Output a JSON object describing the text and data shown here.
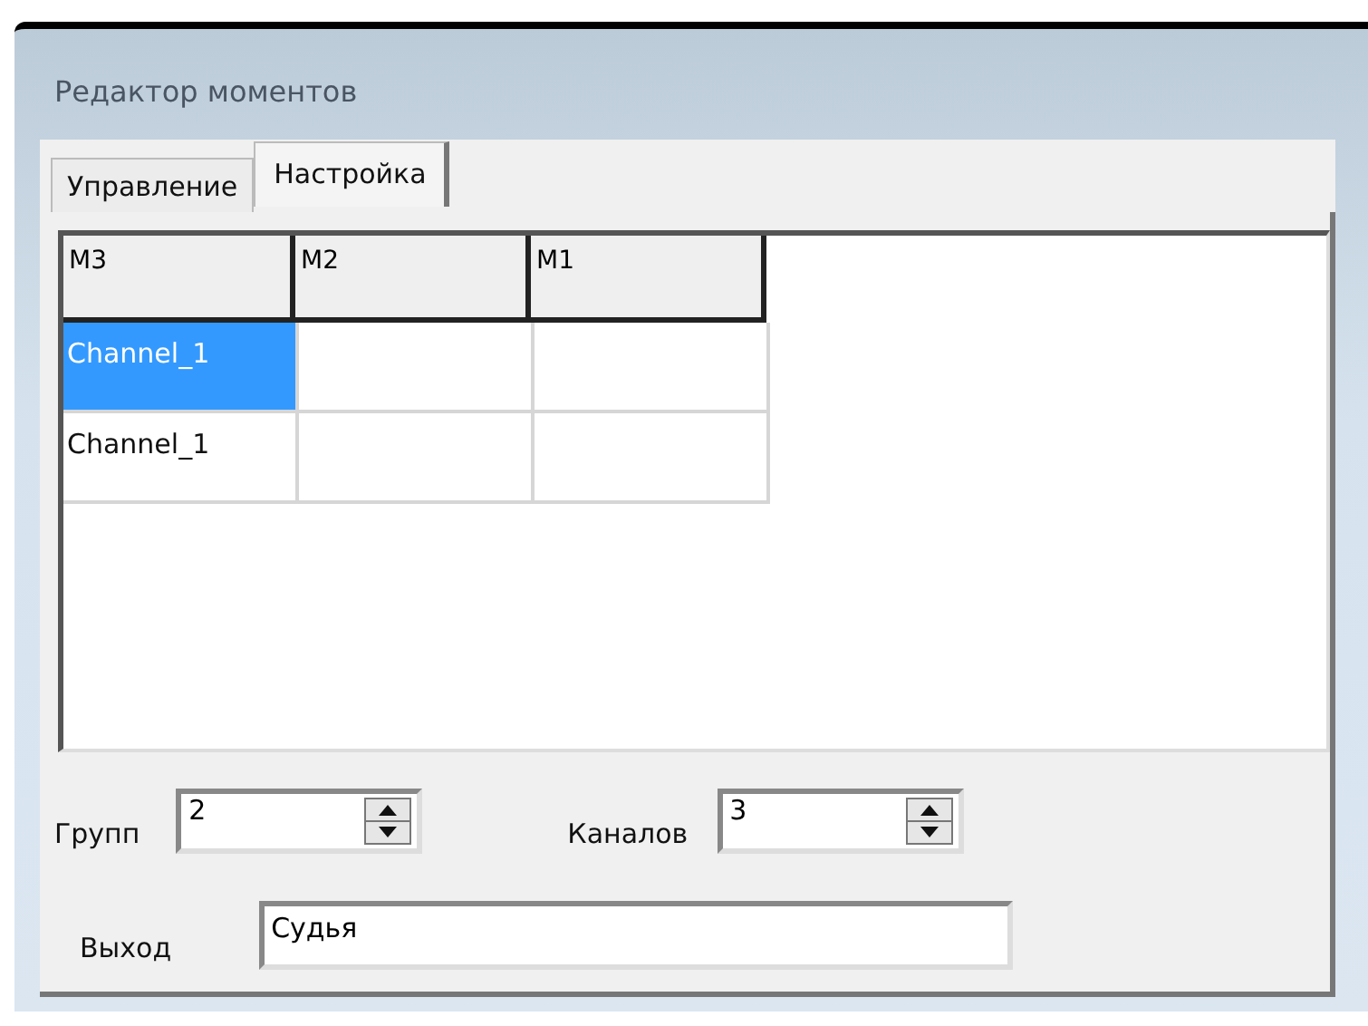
{
  "window": {
    "title": "Редактор моментов"
  },
  "tabs": [
    {
      "label": "Управление",
      "selected": false
    },
    {
      "label": "Настройка",
      "selected": true
    }
  ],
  "table": {
    "columns": [
      "M3",
      "M2",
      "M1"
    ],
    "rows": [
      {
        "label": "Channel_1",
        "selected": true
      },
      {
        "label": "Channel_1",
        "selected": false
      }
    ]
  },
  "spinners": [
    {
      "label": "Групп",
      "value": "2"
    },
    {
      "label": "Каналов",
      "value": "3"
    }
  ],
  "output": {
    "label": "Выход",
    "value": "Судья"
  }
}
